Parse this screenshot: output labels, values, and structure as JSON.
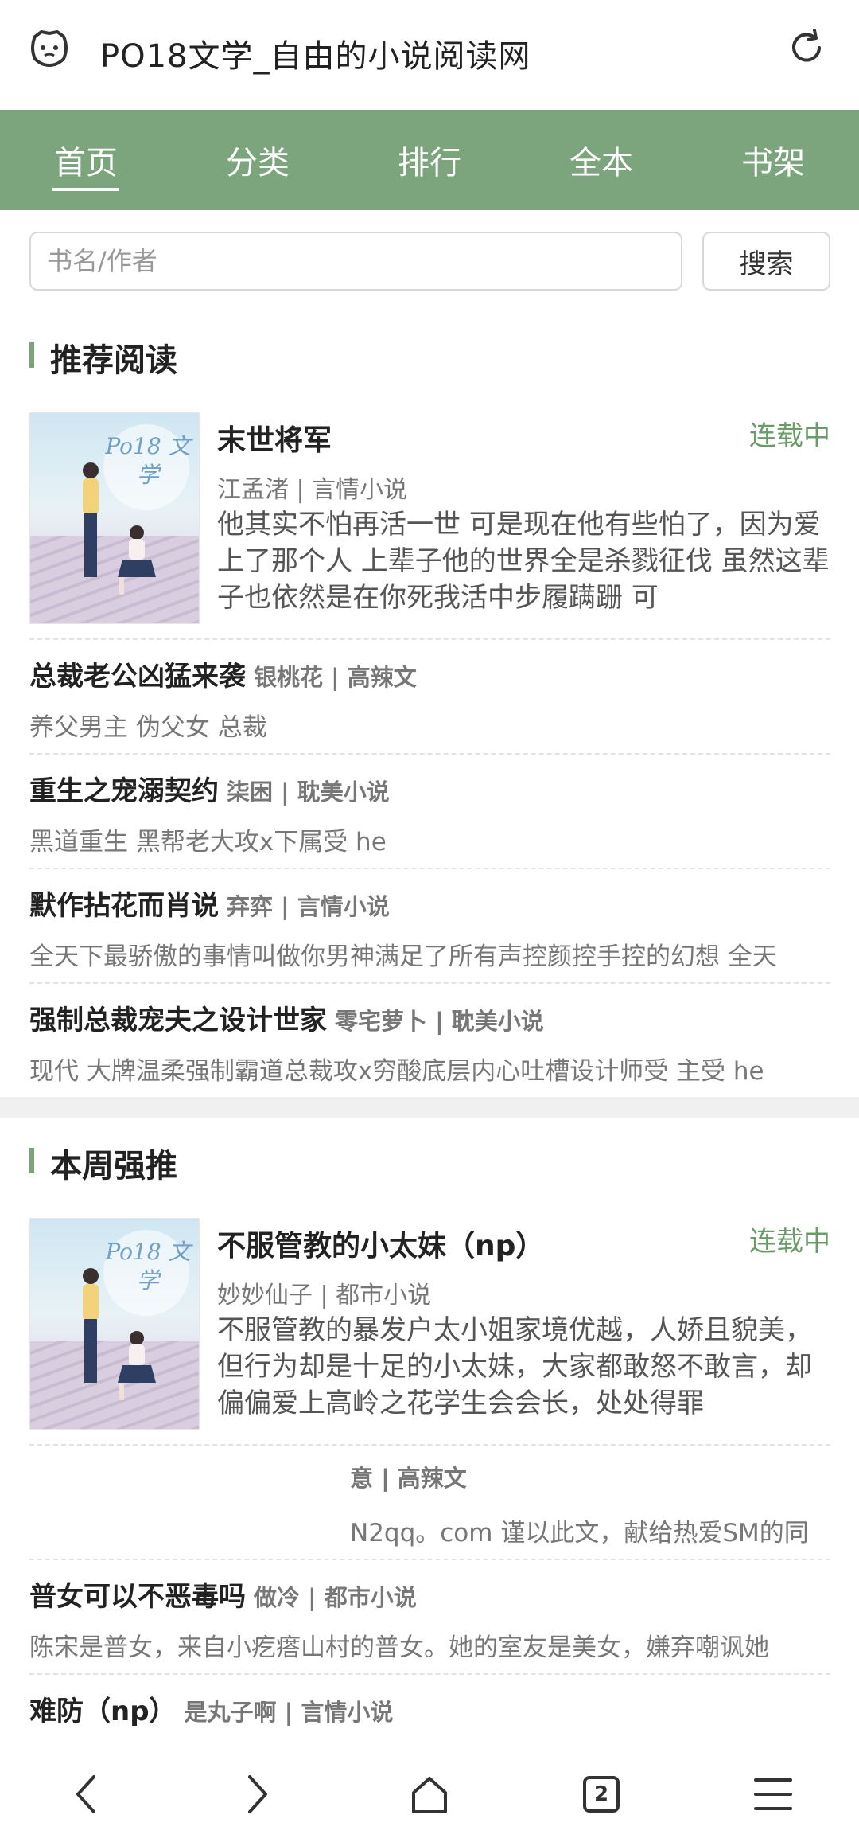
{
  "browser": {
    "page_title": "PO18文学_自由的小说阅读网",
    "tab_count": "2"
  },
  "nav": {
    "tabs": [
      {
        "label": "首页",
        "active": true
      },
      {
        "label": "分类"
      },
      {
        "label": "排行"
      },
      {
        "label": "全本"
      },
      {
        "label": "书架"
      }
    ]
  },
  "search": {
    "placeholder": "书名/作者",
    "button_label": "搜索"
  },
  "cover_text": "Po18 文学",
  "recommended": {
    "title": "推荐阅读",
    "featured": {
      "title": "末世将军",
      "status": "连载中",
      "meta": "江孟渚 | 言情小说",
      "description": "他其实不怕再活一世 可是现在他有些怕了，因为爱上了那个人 上辈子他的世界全是杀戮征伐 虽然这辈子也依然是在你死我活中步履蹒跚 可"
    },
    "items": [
      {
        "name": "总裁老公凶猛来袭",
        "info": "银桃花 | 高辣文",
        "summary": "养父男主 伪父女 总裁"
      },
      {
        "name": "重生之宠溺契约",
        "info": "柒困 | 耽美小说",
        "summary": "黑道重生 黑帮老大攻x下属受 he"
      },
      {
        "name": "默作拈花而肖说",
        "info": "弃弈 | 言情小说",
        "summary": "全天下最骄傲的事情叫做你男神满足了所有声控颜控手控的幻想 全天"
      },
      {
        "name": "强制总裁宠夫之设计世家",
        "info": "零宅萝卜 | 耽美小说",
        "summary": "现代 大牌温柔强制霸道总裁攻x穷酸底层内心吐槽设计师受 主受 he"
      }
    ]
  },
  "weekly": {
    "title": "本周强推",
    "featured": {
      "title": "不服管教的小太妹（np）",
      "status": "连载中",
      "meta": "妙妙仙子 | 都市小说",
      "description": "不服管教的暴发户太小姐家境优越，人娇且貌美，但行为却是十足的小太妹，大家都敢怒不敢言，却偏偏爱上高岭之花学生会会长，处处得罪"
    },
    "items": [
      {
        "name": "",
        "info": "意 | 高辣文",
        "summary": "N2qq。com 谨以此文，献给热爱SM的同"
      },
      {
        "name": "普女可以不恶毒吗",
        "info": "做冷 | 都市小说",
        "summary": "陈宋是普女，来自小疙瘩山村的普女。她的室友是美女，嫌弃嘲讽她"
      },
      {
        "name": "难防（np）",
        "info": "是丸子啊 | 言情小说",
        "summary": ""
      }
    ]
  }
}
